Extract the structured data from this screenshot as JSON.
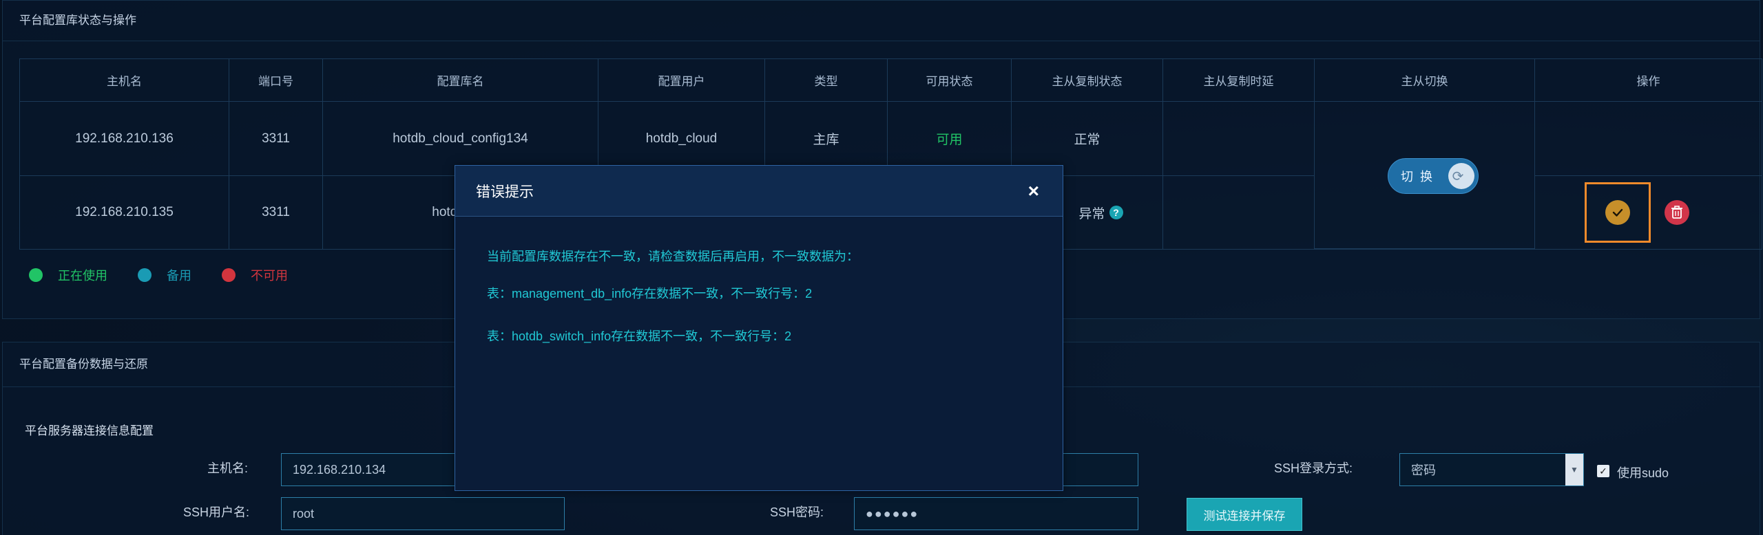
{
  "colors": {
    "in_use": "#21c466",
    "standby": "#1a9bb4",
    "unavailable": "#d2353e",
    "accent_cyan": "#21c9d5",
    "focus_orange": "#f08a2b"
  },
  "status_panel": {
    "title": "平台配置库状态与操作",
    "columns": [
      "主机名",
      "端口号",
      "配置库名",
      "配置用户",
      "类型",
      "可用状态",
      "主从复制状态",
      "主从复制时延",
      "主从切换",
      "操作"
    ],
    "rows": [
      {
        "host": "192.168.210.136",
        "port": "3311",
        "db": "hotdb_cloud_config134",
        "user": "hotdb_cloud",
        "type": "主库",
        "avail": "可用",
        "repl": "正常",
        "delay": ""
      },
      {
        "host": "192.168.210.135",
        "port": "3311",
        "db": "hotdb_clo",
        "user": "",
        "type": "",
        "avail": "",
        "repl": "异常",
        "delay": ""
      }
    ],
    "switch_label": "切换",
    "legend": [
      {
        "label": "正在使用",
        "color": "#21c466"
      },
      {
        "label": "备用",
        "color": "#1a9bb4"
      },
      {
        "label": "不可用",
        "color": "#d2353e"
      }
    ]
  },
  "backup_panel": {
    "title": "平台配置备份数据与还原",
    "section_title": "平台服务器连接信息配置",
    "host_label": "主机名:",
    "host_value": "192.168.210.134",
    "ssh_user_label": "SSH用户名:",
    "ssh_user_value": "root",
    "ssh_pwd_label": "SSH密码:",
    "ssh_pwd_value": "●●●●●●",
    "ssh_method_label": "SSH登录方式:",
    "ssh_method_value": "密码",
    "sudo_label": "使用sudo",
    "save_button": "测试连接并保存"
  },
  "modal": {
    "title": "错误提示",
    "close_glyph": "×",
    "lines": [
      "当前配置库数据存在不一致，请检查数据后再启用，不一致数据为：",
      "表：management_db_info存在数据不一致，不一致行号：2",
      "表：hotdb_switch_info存在数据不一致，不一致行号：2"
    ]
  }
}
